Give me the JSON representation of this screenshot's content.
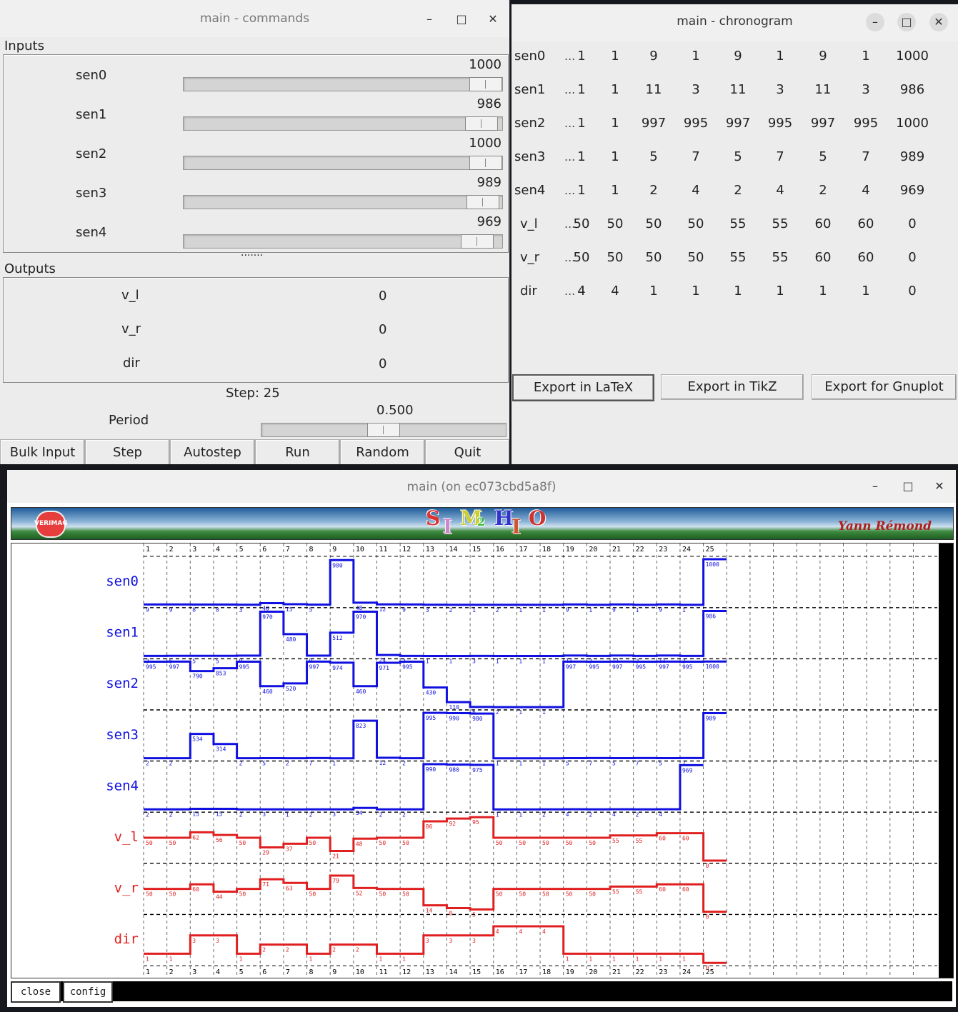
{
  "commands": {
    "title": "main - commands",
    "inputs_label": "Inputs",
    "outputs_label": "Outputs",
    "splitter": "·······",
    "inputs": [
      {
        "name": "sen0",
        "value": "1000",
        "fraction": 1.0
      },
      {
        "name": "sen1",
        "value": "986",
        "fraction": 0.986
      },
      {
        "name": "sen2",
        "value": "1000",
        "fraction": 1.0
      },
      {
        "name": "sen3",
        "value": "989",
        "fraction": 0.989
      },
      {
        "name": "sen4",
        "value": "969",
        "fraction": 0.969
      }
    ],
    "outputs": [
      {
        "name": "v_l",
        "value": "0"
      },
      {
        "name": "v_r",
        "value": "0"
      },
      {
        "name": "dir",
        "value": "0"
      }
    ],
    "step_text": "Step: 25",
    "period_label": "Period",
    "period_value": "0.500",
    "period_fraction": 0.5,
    "buttons": [
      "Bulk Input",
      "Step",
      "Autostep",
      "Run",
      "Random",
      "Quit"
    ],
    "window_buttons": [
      "–",
      "□",
      "✕"
    ]
  },
  "chronogram": {
    "title": "main - chronogram",
    "ellipsis": "...",
    "rows": [
      {
        "name": "sen0",
        "values": [
          "1",
          "1",
          "9",
          "1",
          "9",
          "1",
          "9",
          "1",
          "1000"
        ]
      },
      {
        "name": "sen1",
        "values": [
          "1",
          "1",
          "11",
          "3",
          "11",
          "3",
          "11",
          "3",
          "986"
        ]
      },
      {
        "name": "sen2",
        "values": [
          "1",
          "1",
          "997",
          "995",
          "997",
          "995",
          "997",
          "995",
          "1000"
        ]
      },
      {
        "name": "sen3",
        "values": [
          "1",
          "1",
          "5",
          "7",
          "5",
          "7",
          "5",
          "7",
          "989"
        ]
      },
      {
        "name": "sen4",
        "values": [
          "1",
          "1",
          "2",
          "4",
          "2",
          "4",
          "2",
          "4",
          "969"
        ]
      },
      {
        "name": "v_l",
        "values": [
          "50",
          "50",
          "50",
          "50",
          "55",
          "55",
          "60",
          "60",
          "0"
        ]
      },
      {
        "name": "v_r",
        "values": [
          "50",
          "50",
          "50",
          "50",
          "55",
          "55",
          "60",
          "60",
          "0"
        ]
      },
      {
        "name": "dir",
        "values": [
          "4",
          "4",
          "1",
          "1",
          "1",
          "1",
          "1",
          "1",
          "0"
        ]
      }
    ],
    "buttons": [
      "Export in LaTeX",
      "Export in TikZ",
      "Export for Gnuplot"
    ],
    "window_buttons": [
      "–",
      "□",
      "✕"
    ]
  },
  "simulator": {
    "title": "main (on ec073cbd5a8f)",
    "logo_left": "VERIMAG",
    "logo_letters": [
      "S",
      "I",
      "M",
      "2",
      "H",
      "I",
      "O"
    ],
    "logo_colors": [
      "#d33",
      "#c8c",
      "#cc3",
      "#3b3",
      "#33c",
      "#c53",
      "#c33"
    ],
    "author": "Yann Rémond",
    "bottom_buttons": [
      "close",
      "config"
    ],
    "window_buttons": [
      "–",
      "□",
      "✕"
    ]
  },
  "chart_data": {
    "type": "line",
    "x": [
      1,
      2,
      3,
      4,
      5,
      6,
      7,
      8,
      9,
      10,
      11,
      12,
      13,
      14,
      15,
      16,
      17,
      18,
      19,
      20,
      21,
      22,
      23,
      24,
      25
    ],
    "series": [
      {
        "name": "sen0",
        "color": "#1010e0",
        "min": 0,
        "max": 1000,
        "values": [
          9,
          9,
          8,
          8,
          3,
          40,
          15,
          5,
          980,
          48,
          12,
          9,
          3,
          2,
          1,
          2,
          1,
          1,
          9,
          1,
          9,
          1,
          9,
          1,
          1000
        ]
      },
      {
        "name": "sen1",
        "color": "#1010e0",
        "min": 0,
        "max": 1000,
        "values": [
          3,
          5,
          5,
          5,
          9,
          970,
          480,
          9,
          512,
          970,
          24,
          3,
          1,
          1,
          3,
          1,
          1,
          1,
          11,
          3,
          11,
          3,
          11,
          3,
          986
        ]
      },
      {
        "name": "sen2",
        "color": "#1010e0",
        "min": 0,
        "max": 1000,
        "values": [
          995,
          997,
          790,
          853,
          995,
          460,
          520,
          997,
          974,
          460,
          971,
          995,
          430,
          110,
          6,
          2,
          1,
          1,
          997,
          995,
          997,
          995,
          997,
          995,
          1000
        ]
      },
      {
        "name": "sen3",
        "color": "#1010e0",
        "min": 0,
        "max": 1000,
        "values": [
          2,
          2,
          534,
          314,
          2,
          5,
          2,
          7,
          1,
          823,
          12,
          2,
          995,
          990,
          980,
          1,
          1,
          1,
          5,
          7,
          5,
          7,
          5,
          7,
          989
        ]
      },
      {
        "name": "sen4",
        "color": "#1010e0",
        "min": 0,
        "max": 1000,
        "values": [
          2,
          2,
          15,
          15,
          2,
          3,
          1,
          2,
          3,
          34,
          2,
          2,
          990,
          980,
          975,
          1,
          1,
          2,
          4,
          2,
          4,
          2,
          4,
          969
        ]
      },
      {
        "name": "v_l",
        "color": "#e02020",
        "min": 0,
        "max": 100,
        "values": [
          50,
          50,
          62,
          56,
          50,
          29,
          37,
          50,
          21,
          48,
          50,
          50,
          86,
          92,
          95,
          50,
          50,
          50,
          50,
          50,
          55,
          55,
          60,
          60,
          0
        ]
      },
      {
        "name": "v_r",
        "color": "#e02020",
        "min": 0,
        "max": 100,
        "values": [
          50,
          50,
          60,
          44,
          50,
          71,
          63,
          50,
          79,
          52,
          50,
          50,
          14,
          8,
          5,
          50,
          50,
          50,
          50,
          50,
          55,
          55,
          60,
          60,
          0
        ]
      },
      {
        "name": "dir",
        "color": "#e02020",
        "min": 0,
        "max": 5,
        "values": [
          1,
          1,
          3,
          3,
          1,
          2,
          2,
          1,
          2,
          2,
          1,
          1,
          3,
          3,
          3,
          4,
          4,
          4,
          1,
          1,
          1,
          1,
          1,
          1,
          0
        ]
      }
    ],
    "grid": true,
    "tick_labels": [
      "1",
      "2",
      "3",
      "4",
      "5",
      "6",
      "7",
      "8",
      "9",
      "10",
      "11",
      "12",
      "13",
      "14",
      "15",
      "16",
      "17",
      "18",
      "19",
      "20",
      "21",
      "22",
      "23",
      "24",
      "25"
    ]
  }
}
